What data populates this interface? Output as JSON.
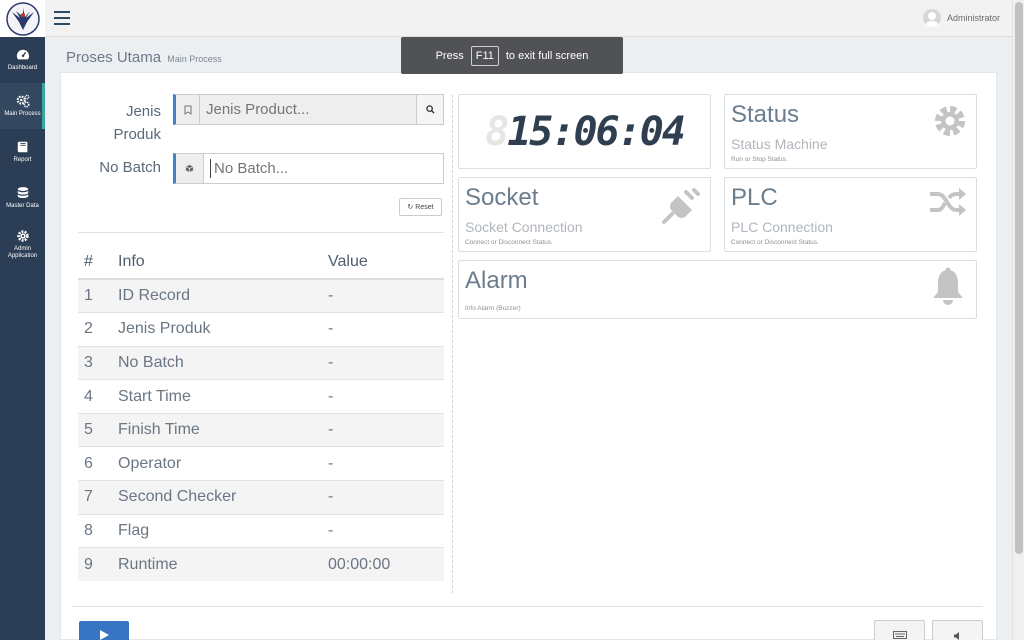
{
  "header": {
    "user_name": "Administrator",
    "menu_icon": "hamburger-menu-icon",
    "logo_icon": "eagle-logo-icon"
  },
  "sidebar": {
    "items": [
      {
        "label": "Dashboard",
        "icon": "dashboard-gauge-icon",
        "active": false
      },
      {
        "label": "Main Process",
        "icon": "cogs-icon",
        "active": true
      },
      {
        "label": "Report",
        "icon": "book-icon",
        "active": false
      },
      {
        "label": "Master Data",
        "icon": "database-icon",
        "active": false
      },
      {
        "label": "Admin Application",
        "icon": "gear-icon",
        "active": false
      }
    ]
  },
  "fullscreen_toast": {
    "prefix": "Press",
    "key": "F11",
    "suffix": "to exit full screen"
  },
  "page": {
    "title": "Proses Utama",
    "subtitle": "Main Process"
  },
  "form": {
    "jenis_label_1": "Jenis",
    "jenis_label_2": "Produk",
    "jenis_placeholder": "Jenis Product...",
    "batch_label": "No Batch",
    "batch_placeholder": "No Batch...",
    "reset_label": "Reset"
  },
  "info_table": {
    "headers": {
      "num": "#",
      "info": "Info",
      "value": "Value"
    },
    "rows": [
      {
        "num": "1",
        "info": "ID Record",
        "value": "-"
      },
      {
        "num": "2",
        "info": "Jenis Produk",
        "value": "-"
      },
      {
        "num": "3",
        "info": "No Batch",
        "value": "-"
      },
      {
        "num": "4",
        "info": "Start Time",
        "value": "-"
      },
      {
        "num": "5",
        "info": "Finish Time",
        "value": "-"
      },
      {
        "num": "6",
        "info": "Operator",
        "value": "-"
      },
      {
        "num": "7",
        "info": "Second Checker",
        "value": "-"
      },
      {
        "num": "8",
        "info": "Flag",
        "value": "-"
      },
      {
        "num": "9",
        "info": "Runtime",
        "value": "00:00:00"
      }
    ]
  },
  "clock": {
    "ghost": "8",
    "time": "15:06:04"
  },
  "tiles": {
    "status": {
      "title": "Status",
      "subtitle": "Status Machine",
      "note": "Run or Stop Status.",
      "icon": "gear-icon"
    },
    "socket": {
      "title": "Socket",
      "subtitle": "Socket Connection",
      "note": "Connect or Disconnect Status.",
      "icon": "plug-icon"
    },
    "plc": {
      "title": "PLC",
      "subtitle": "PLC Connection",
      "note": "Connect or Disconnect Status.",
      "icon": "random-shuffle-icon"
    },
    "alarm": {
      "title": "Alarm",
      "note": "Info Alarm (Buzzer)",
      "icon": "bell-icon"
    }
  },
  "colors": {
    "sidebar_bg": "#2c3e55",
    "accent": "#3aa6a0",
    "primary": "#3575c3"
  }
}
